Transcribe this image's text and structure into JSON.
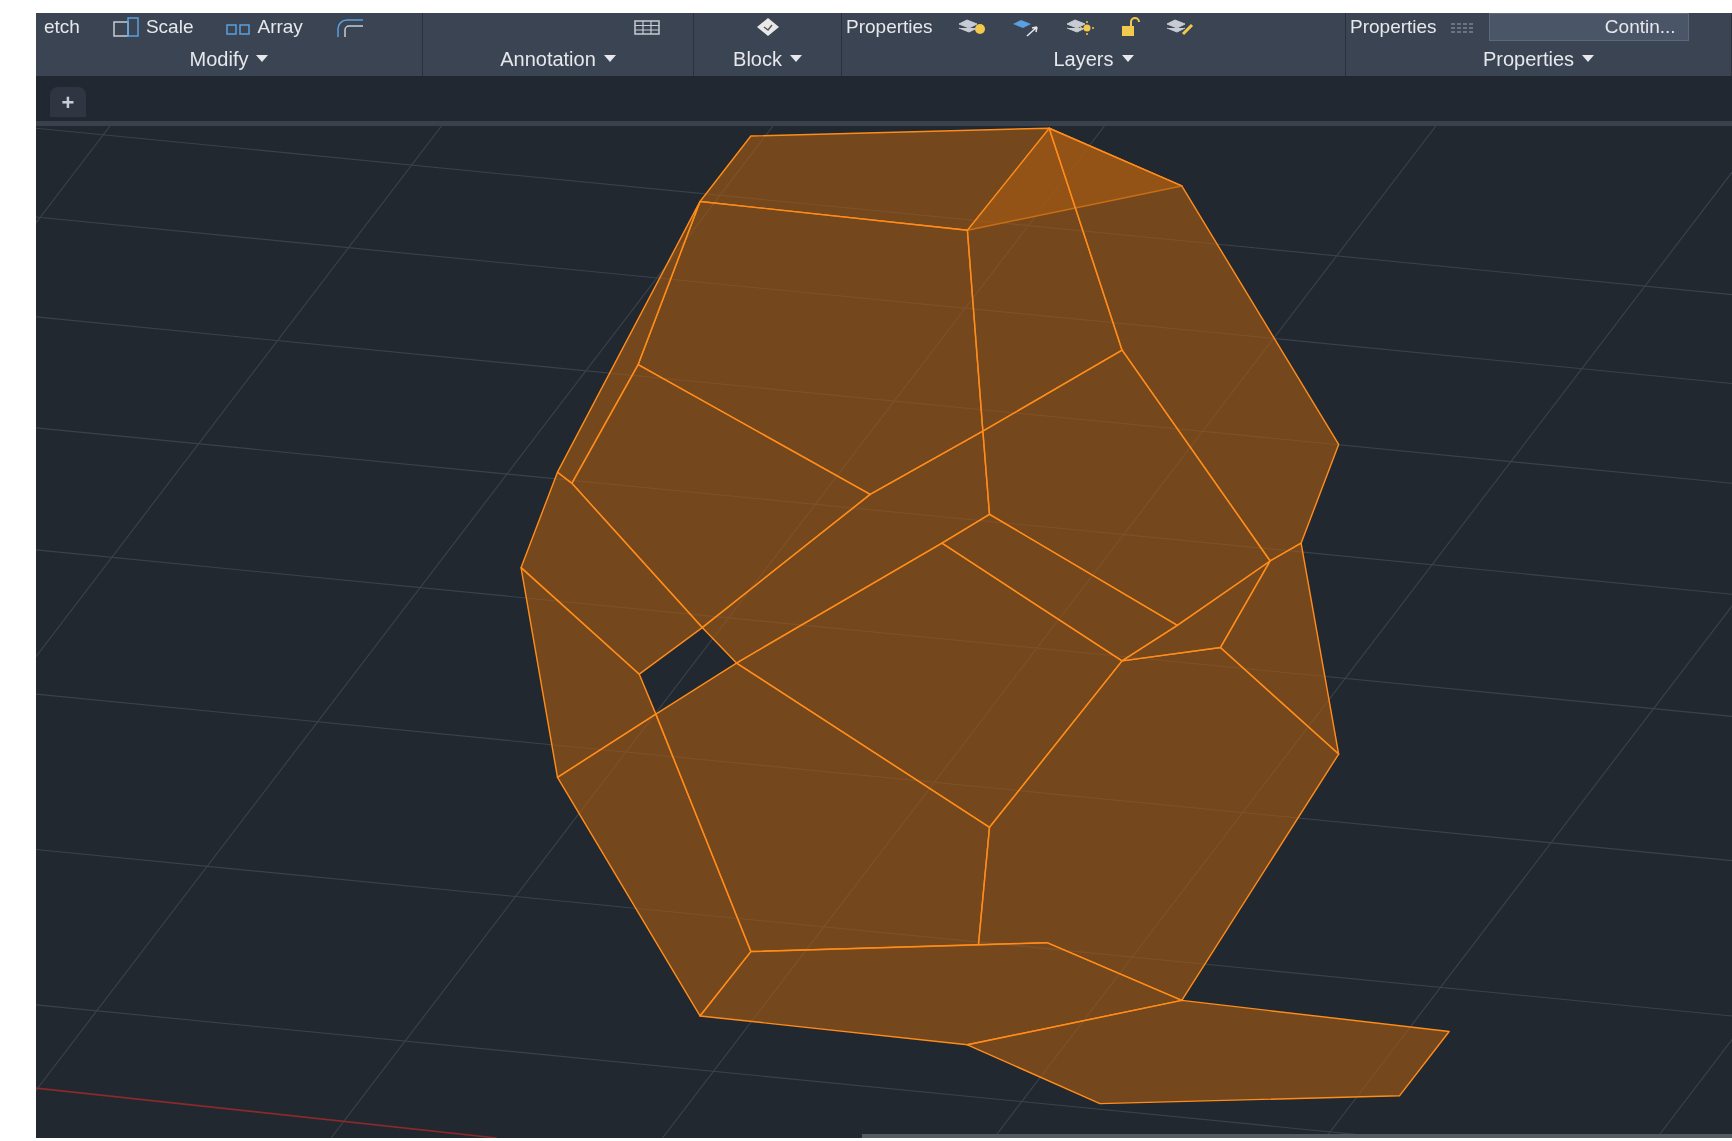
{
  "ribbon": {
    "panels": [
      {
        "title": "Modify",
        "tools": [
          {
            "kind": "cut",
            "label": "etch"
          },
          {
            "kind": "scale",
            "label": "Scale"
          },
          {
            "kind": "array",
            "label": "Array"
          },
          {
            "kind": "fillet"
          }
        ]
      },
      {
        "title": "Annotation",
        "tools": [
          {
            "kind": "table"
          }
        ]
      },
      {
        "title": "Block",
        "tools": [
          {
            "kind": "block"
          }
        ]
      },
      {
        "title": "Layers",
        "tools": [
          {
            "kind": "cut",
            "label": "Properties"
          },
          {
            "kind": "layer-bulb"
          },
          {
            "kind": "layer-arrow"
          },
          {
            "kind": "layer-sun"
          },
          {
            "kind": "layer-lock"
          },
          {
            "kind": "layer-brush"
          }
        ]
      },
      {
        "title": "Properties",
        "tools": [
          {
            "kind": "cut",
            "label": "Properties"
          },
          {
            "kind": "linetype"
          },
          {
            "kind": "field",
            "value": "Contin..."
          }
        ]
      }
    ]
  },
  "file_tabs": {
    "new_tab": "+"
  }
}
